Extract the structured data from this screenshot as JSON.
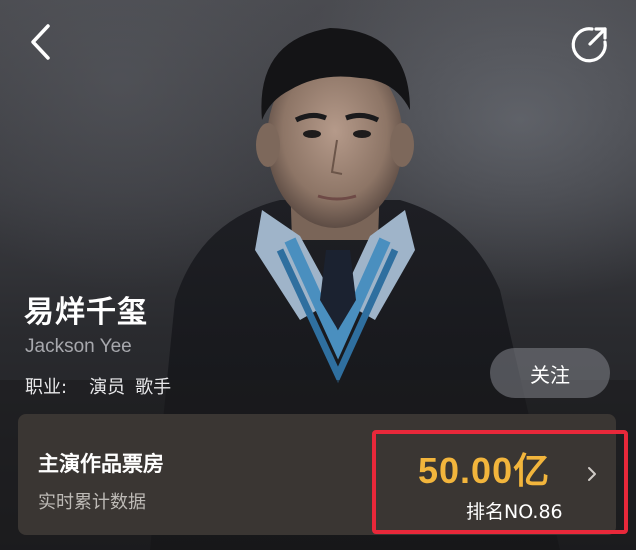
{
  "header": {
    "back_icon": "chevron-left-icon",
    "share_icon": "share-icon"
  },
  "profile": {
    "name": "易烊千玺",
    "english_name": "Jackson Yee",
    "profession_label": "职业:",
    "roles": [
      "演员",
      "歌手"
    ],
    "follow_label": "关注"
  },
  "box_office": {
    "title": "主演作品票房",
    "subtitle": "实时累计数据",
    "value": "50.00亿",
    "rank": "排名NO.86",
    "value_color": "#f2b53c",
    "highlight_color": "#e8283a"
  }
}
